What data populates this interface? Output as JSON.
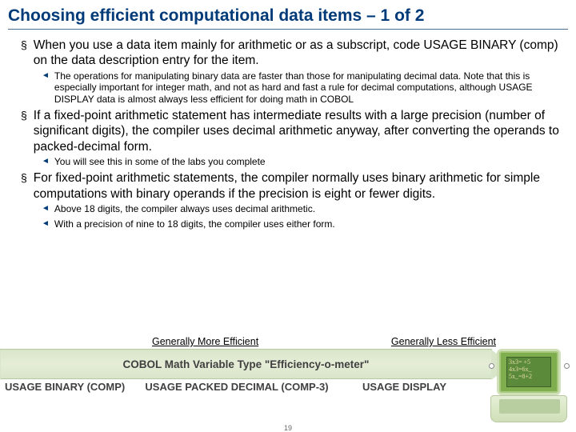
{
  "title": "Choosing efficient computational data items – 1 of 2",
  "items": [
    {
      "text": "When you use a data item mainly for arithmetic or as a subscript, code USAGE BINARY (comp) on the data description entry for the item.",
      "subs": [
        "The operations for manipulating binary data are faster than those for manipulating decimal data. Note that this is especially important for integer math, and not as hard and fast a rule for decimal computations, although USAGE DISPLAY data is almost always less efficient for doing math in COBOL"
      ]
    },
    {
      "text": "If a fixed-point arithmetic statement has intermediate results with a large precision (number of significant digits), the compiler uses decimal arithmetic anyway, after converting the operands to packed-decimal form.",
      "subs": [
        "You will see this in some of the labs you complete"
      ]
    },
    {
      "text": "For fixed-point arithmetic statements, the compiler normally uses binary arithmetic for simple computations with binary operands if the precision is eight or fewer digits.",
      "subs": [
        "Above 18 digits, the compiler always uses decimal arithmetic.",
        "With a precision of nine to 18 digits, the compiler uses either form."
      ]
    }
  ],
  "meter": {
    "left_label": "Generally More Efficient",
    "right_label": "Generally Less Efficient",
    "title": "COBOL Math Variable Type \"Efficiency-o-meter\"",
    "cat1": "USAGE BINARY (COMP)",
    "cat2": "USAGE PACKED DECIMAL (COMP-3)",
    "cat3": "USAGE DISPLAY"
  },
  "laptop_math": "3x3= +5\n4x3=6x_\n5x_=8+2",
  "page_num": "19"
}
